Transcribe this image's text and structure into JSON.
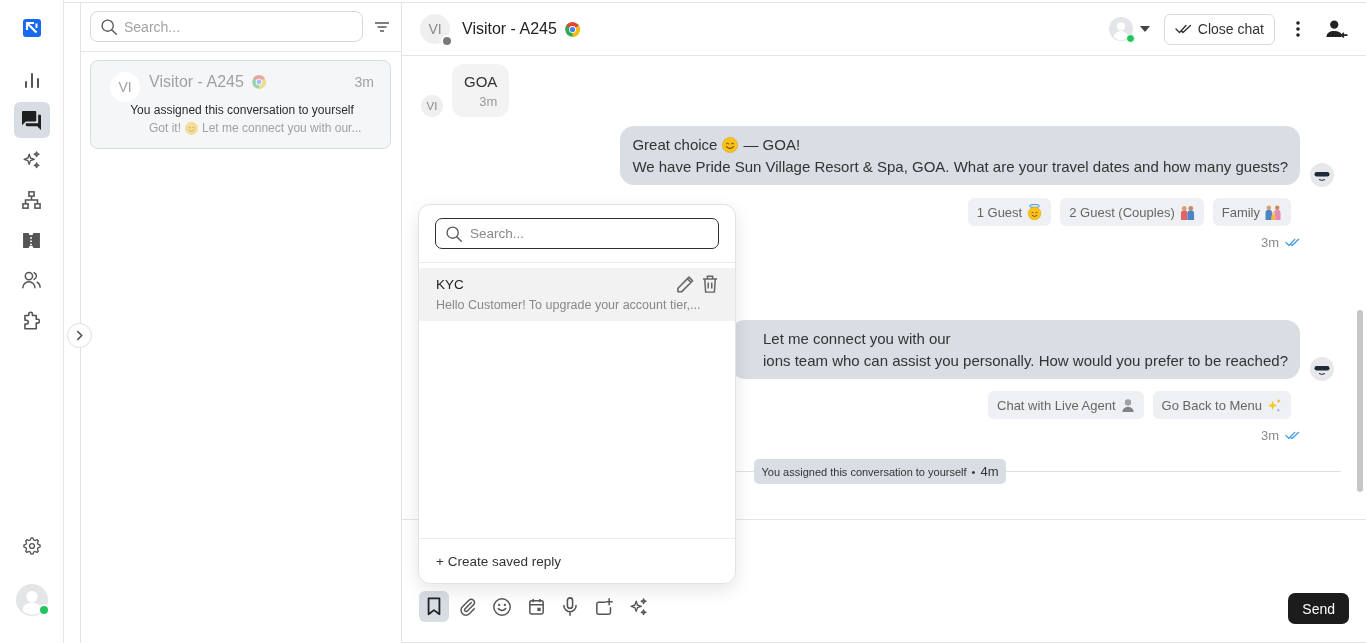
{
  "nav": {
    "items": [
      {
        "selected": false
      },
      {
        "selected": true
      },
      {
        "selected": false
      },
      {
        "selected": false
      },
      {
        "selected": false
      },
      {
        "selected": false
      },
      {
        "selected": false
      }
    ],
    "user": {
      "online": true
    }
  },
  "conversation_list": {
    "search": {
      "placeholder": "Search..."
    },
    "conversations": [
      {
        "avatar": "VI",
        "name": "Visitor - A245",
        "time": "3m",
        "note": "You assigned this conversation to yourself",
        "preview": [
          "Got it!",
          "Let me connect you with our..."
        ],
        "selected": true
      }
    ]
  },
  "chat": {
    "header": {
      "avatar": "VI",
      "name": "Visitor - A245",
      "online": false,
      "agent_online": true,
      "close_button": "Close chat"
    },
    "messages": [
      {
        "kind": "incoming",
        "avatar": "VI",
        "lines": [
          [
            "GOA"
          ]
        ],
        "time": "3m"
      },
      {
        "kind": "outgoing",
        "lines": [
          [
            "Great choice",
            "— GOA!"
          ],
          [
            "We have Pride Sun Village Resort & Spa, GOA. What are your travel dates and how many guests?"
          ]
        ],
        "quick_replies": [
          "1 Guest",
          "2 Guest (Couples)",
          "Family"
        ],
        "time": "3m",
        "read": true
      },
      {
        "kind": "outgoing",
        "lines": [
          [
            "Let me connect you with our"
          ],
          [
            "ions team who can assist you personally. How would you prefer to be reached?"
          ]
        ],
        "quick_replies": [
          "Chat with Live Agent",
          "Go Back to Menu"
        ],
        "time": "3m",
        "read": true
      },
      {
        "kind": "system",
        "text": "You assigned this conversation to yourself",
        "separator": "•",
        "time": "4m"
      }
    ],
    "saved_replies": {
      "search": {
        "placeholder": "Search..."
      },
      "items": [
        {
          "title": "KYC",
          "preview": "Hello Customer! To upgrade your account tier,...",
          "selected": true
        }
      ],
      "create_label": "+ Create saved reply"
    },
    "composer": {
      "tools": [
        {
          "selected": true
        },
        {
          "selected": false
        },
        {
          "selected": false
        },
        {
          "selected": false
        },
        {
          "selected": false
        },
        {
          "selected": false
        },
        {
          "selected": false
        }
      ],
      "send_label": "Send"
    }
  }
}
